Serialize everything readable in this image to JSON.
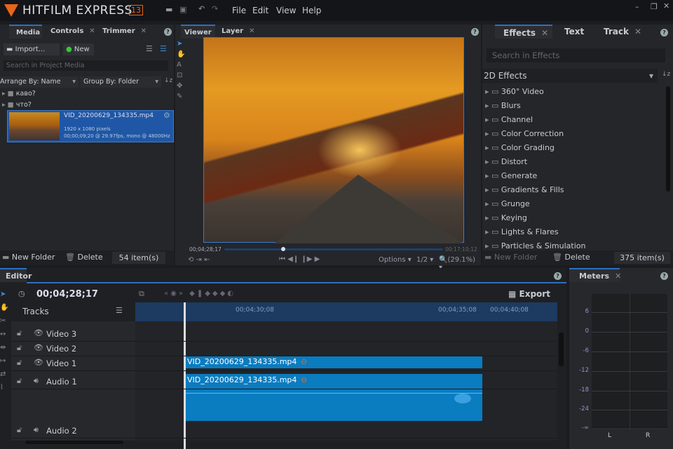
{
  "app": {
    "brand": "HITFILM EXPRESS",
    "version": "13",
    "menu": [
      "File",
      "Edit",
      "View",
      "Help"
    ]
  },
  "media": {
    "tabs": [
      "Media",
      "Controls",
      "Trimmer"
    ],
    "import": "Import...",
    "new": "New",
    "search_placeholder": "Search in Project Media",
    "arrange": "Arrange By: Name",
    "group": "Group By: Folder",
    "folders": [
      "кaвo?",
      "что?"
    ],
    "file": {
      "name": "VID_20200629_134335.mp4",
      "res": "1920 x 1080 pixels",
      "info": "00;00;09;20 @ 29.97fps, mono @ 48000Hz"
    },
    "new_folder": "New Folder",
    "delete": "Delete",
    "count": "54 item(s)"
  },
  "viewer": {
    "tabs": [
      "Viewer",
      "Layer"
    ],
    "current_time": "00;04;28;17",
    "end_time": "00;17;10;12",
    "playhead_fraction": 0.26,
    "options": "Options",
    "resolution": "1/2",
    "zoom": "(29.1%)"
  },
  "effects": {
    "tabs": [
      "Effects",
      "Text",
      "Track"
    ],
    "search_placeholder": "Search in Effects",
    "category": "2D Effects",
    "items": [
      "360° Video",
      "Blurs",
      "Channel",
      "Color Correction",
      "Color Grading",
      "Distort",
      "Generate",
      "Gradients & Fills",
      "Grunge",
      "Keying",
      "Lights & Flares",
      "Particles & Simulation"
    ],
    "new_folder": "New Folder",
    "delete": "Delete",
    "count": "375 item(s)"
  },
  "editor": {
    "title": "Editor",
    "timecode": "00;04;28;17",
    "tracks_label": "Tracks",
    "export": "Export",
    "ruler": [
      "00;04;30;08",
      "00;04;35;08",
      "00;04;40;08"
    ],
    "tracks": [
      "Video 3",
      "Video 2",
      "Video 1",
      "Audio 1",
      "Audio 2"
    ],
    "clip_video": "VID_20200629_134335.mp4",
    "clip_audio": "VID_20200629_134335.mp4"
  },
  "meters": {
    "title": "Meters",
    "scale": [
      "6",
      "0",
      "-6",
      "-12",
      "-18",
      "-24",
      "-∞"
    ],
    "channels": [
      "L",
      "R"
    ]
  }
}
